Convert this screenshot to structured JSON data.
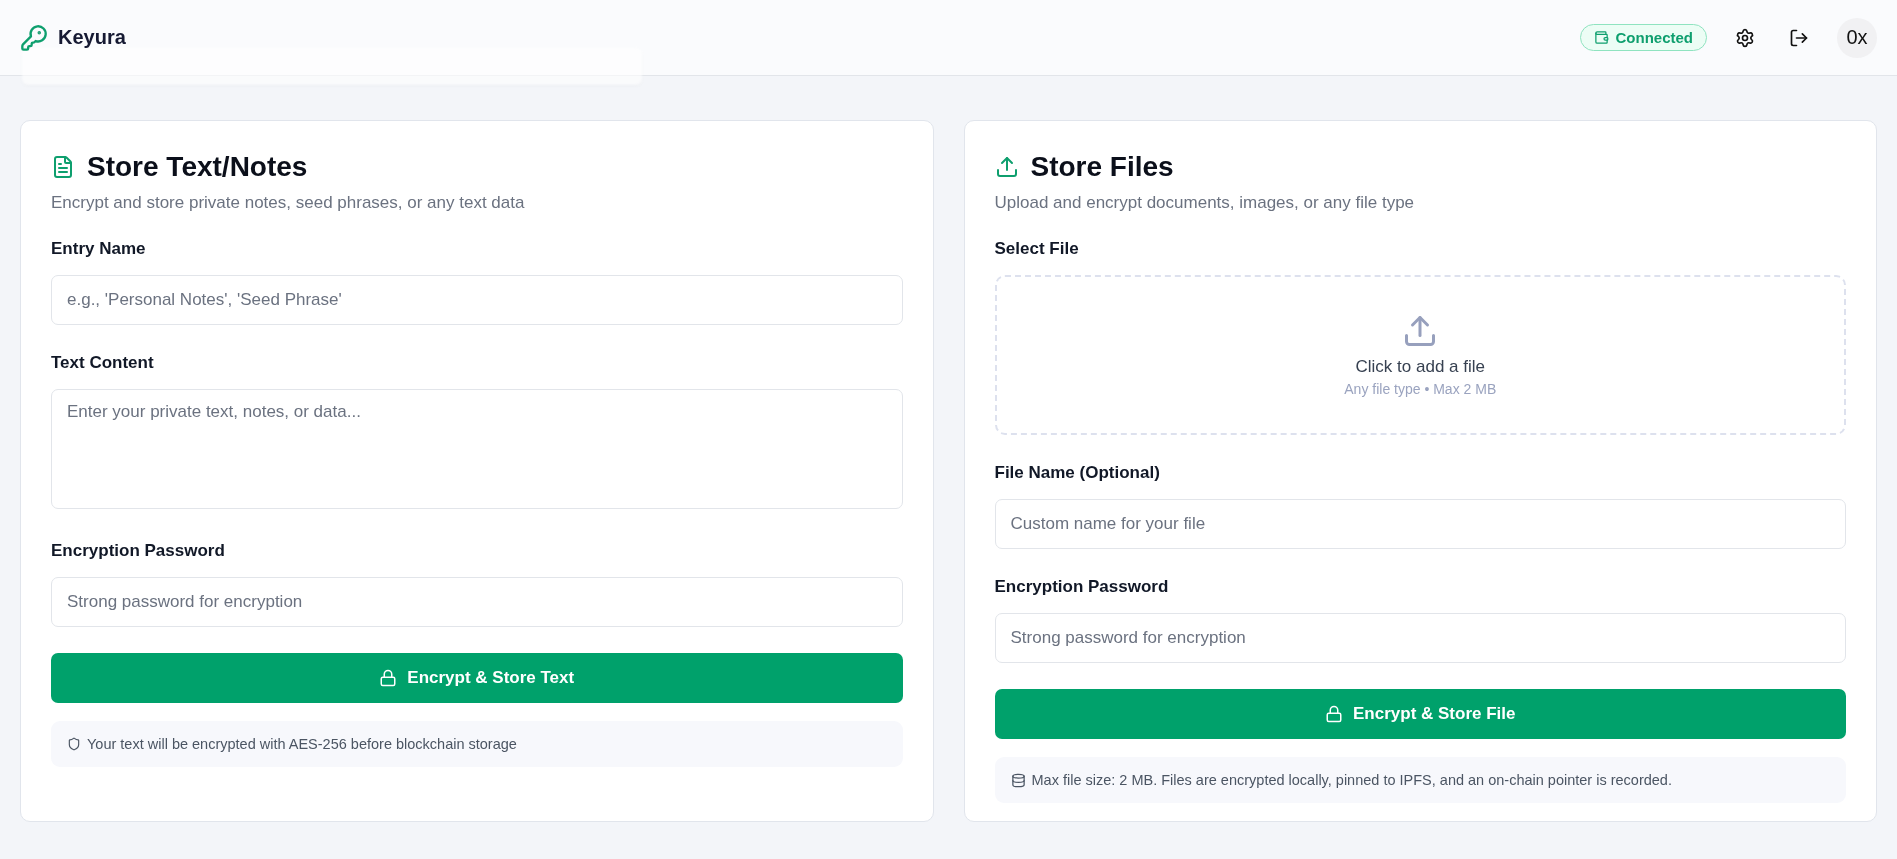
{
  "header": {
    "brand": "Keyura",
    "status": {
      "label": "Connected",
      "connected": true
    },
    "account": "0x"
  },
  "cards": [
    {
      "title": "Store Text/Notes",
      "subtitle": "Encrypt and store private notes, seed phrases, or any text data",
      "fields": [
        {
          "kind": "input",
          "label": "Entry Name",
          "placeholder": "e.g., 'Personal Notes', 'Seed Phrase'"
        },
        {
          "kind": "textarea",
          "label": "Text Content",
          "placeholder": "Enter your private text, notes, or data..."
        },
        {
          "kind": "input",
          "label": "Encryption Password",
          "placeholder": "Strong password for encryption"
        }
      ],
      "button": "Encrypt & Store Text",
      "note": {
        "text": "Your text will be encrypted with AES-256 before blockchain storage"
      }
    },
    {
      "title": "Store Files",
      "subtitle": "Upload and encrypt documents, images, or any file type",
      "fields": [
        {
          "kind": "dropzone",
          "label": "Select File",
          "title": "Click to add a file",
          "hint": "Any file type • Max 2 MB"
        },
        {
          "kind": "input",
          "label": "File Name (Optional)",
          "placeholder": "Custom name for your file"
        },
        {
          "kind": "input",
          "label": "Encryption Password",
          "placeholder": "Strong password for encryption"
        }
      ],
      "button": "Encrypt & Store File",
      "note": {
        "text": "Max file size: 2 MB. Files are encrypted locally, pinned to IPFS, and an on-chain pointer is recorded."
      }
    }
  ]
}
